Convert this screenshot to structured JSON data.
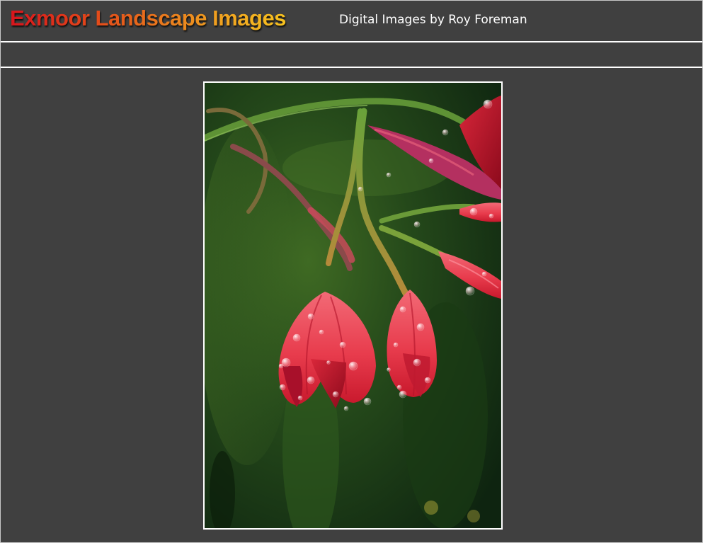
{
  "header": {
    "site_title": "Exmoor Landscape Images",
    "subtitle": "Digital Images by Roy Foreman"
  },
  "colors": {
    "background": "#404040",
    "rule": "#ffffff",
    "title_gradient_start": "#d8141c",
    "title_gradient_end": "#f7c21f",
    "subtitle_text": "#ffffff"
  },
  "photo": {
    "subject": "red-flower-buds-with-raindrops"
  }
}
